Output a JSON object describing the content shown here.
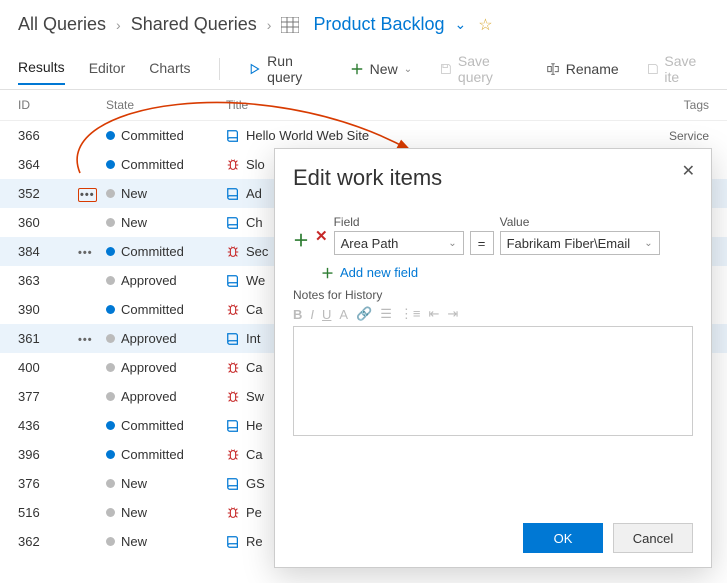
{
  "breadcrumb": {
    "root": "All Queries",
    "mid": "Shared Queries",
    "current": "Product Backlog"
  },
  "tabs": {
    "results": "Results",
    "editor": "Editor",
    "charts": "Charts"
  },
  "toolbar": {
    "run": "Run query",
    "new": "New",
    "savequery": "Save query",
    "rename": "Rename",
    "saveitems": "Save ite"
  },
  "columns": {
    "id": "ID",
    "state": "State",
    "title": "Title",
    "tags": "Tags"
  },
  "states": {
    "committed": "Committed",
    "new": "New",
    "approved": "Approved"
  },
  "rows": [
    {
      "id": "366",
      "dots": "",
      "state": "committed",
      "dot": "blue",
      "icon": "book",
      "title": "Hello World Web Site",
      "tag": "Service"
    },
    {
      "id": "364",
      "dots": "",
      "state": "committed",
      "dot": "blue",
      "icon": "bug",
      "title": "Slo",
      "tag": ""
    },
    {
      "id": "352",
      "dots": "box",
      "state": "new",
      "dot": "grey",
      "icon": "book",
      "title": "Ad",
      "tag": "",
      "sel": true
    },
    {
      "id": "360",
      "dots": "",
      "state": "new",
      "dot": "grey",
      "icon": "book",
      "title": "Ch",
      "tag": ""
    },
    {
      "id": "384",
      "dots": "plain",
      "state": "committed",
      "dot": "blue",
      "icon": "bug",
      "title": "Sec",
      "tag": "",
      "sel": true
    },
    {
      "id": "363",
      "dots": "",
      "state": "approved",
      "dot": "grey",
      "icon": "book",
      "title": "We",
      "tag": ""
    },
    {
      "id": "390",
      "dots": "",
      "state": "committed",
      "dot": "blue",
      "icon": "bug",
      "title": "Ca",
      "tag": ""
    },
    {
      "id": "361",
      "dots": "plain",
      "state": "approved",
      "dot": "grey",
      "icon": "book",
      "title": "Int",
      "tag": "",
      "sel": true
    },
    {
      "id": "400",
      "dots": "",
      "state": "approved",
      "dot": "grey",
      "icon": "bug",
      "title": "Ca",
      "tag": ""
    },
    {
      "id": "377",
      "dots": "",
      "state": "approved",
      "dot": "grey",
      "icon": "bug",
      "title": "Sw",
      "tag": ""
    },
    {
      "id": "436",
      "dots": "",
      "state": "committed",
      "dot": "blue",
      "icon": "book",
      "title": "He",
      "tag": ""
    },
    {
      "id": "396",
      "dots": "",
      "state": "committed",
      "dot": "blue",
      "icon": "bug",
      "title": "Ca",
      "tag": ""
    },
    {
      "id": "376",
      "dots": "",
      "state": "new",
      "dot": "grey",
      "icon": "book",
      "title": "GS",
      "tag": ""
    },
    {
      "id": "516",
      "dots": "",
      "state": "new",
      "dot": "grey",
      "icon": "bug",
      "title": "Pe",
      "tag": ""
    },
    {
      "id": "362",
      "dots": "",
      "state": "new",
      "dot": "grey",
      "icon": "book",
      "title": "Re",
      "tag": ""
    }
  ],
  "dialog": {
    "title": "Edit work items",
    "field_label": "Field",
    "value_label": "Value",
    "field_value": "Area Path",
    "operator": "=",
    "value_value": "Fabrikam Fiber\\Email",
    "add_link": "Add new field",
    "notes_label": "Notes for History",
    "ok": "OK",
    "cancel": "Cancel",
    "fmt": {
      "b": "B",
      "i": "I",
      "u": "U"
    }
  }
}
